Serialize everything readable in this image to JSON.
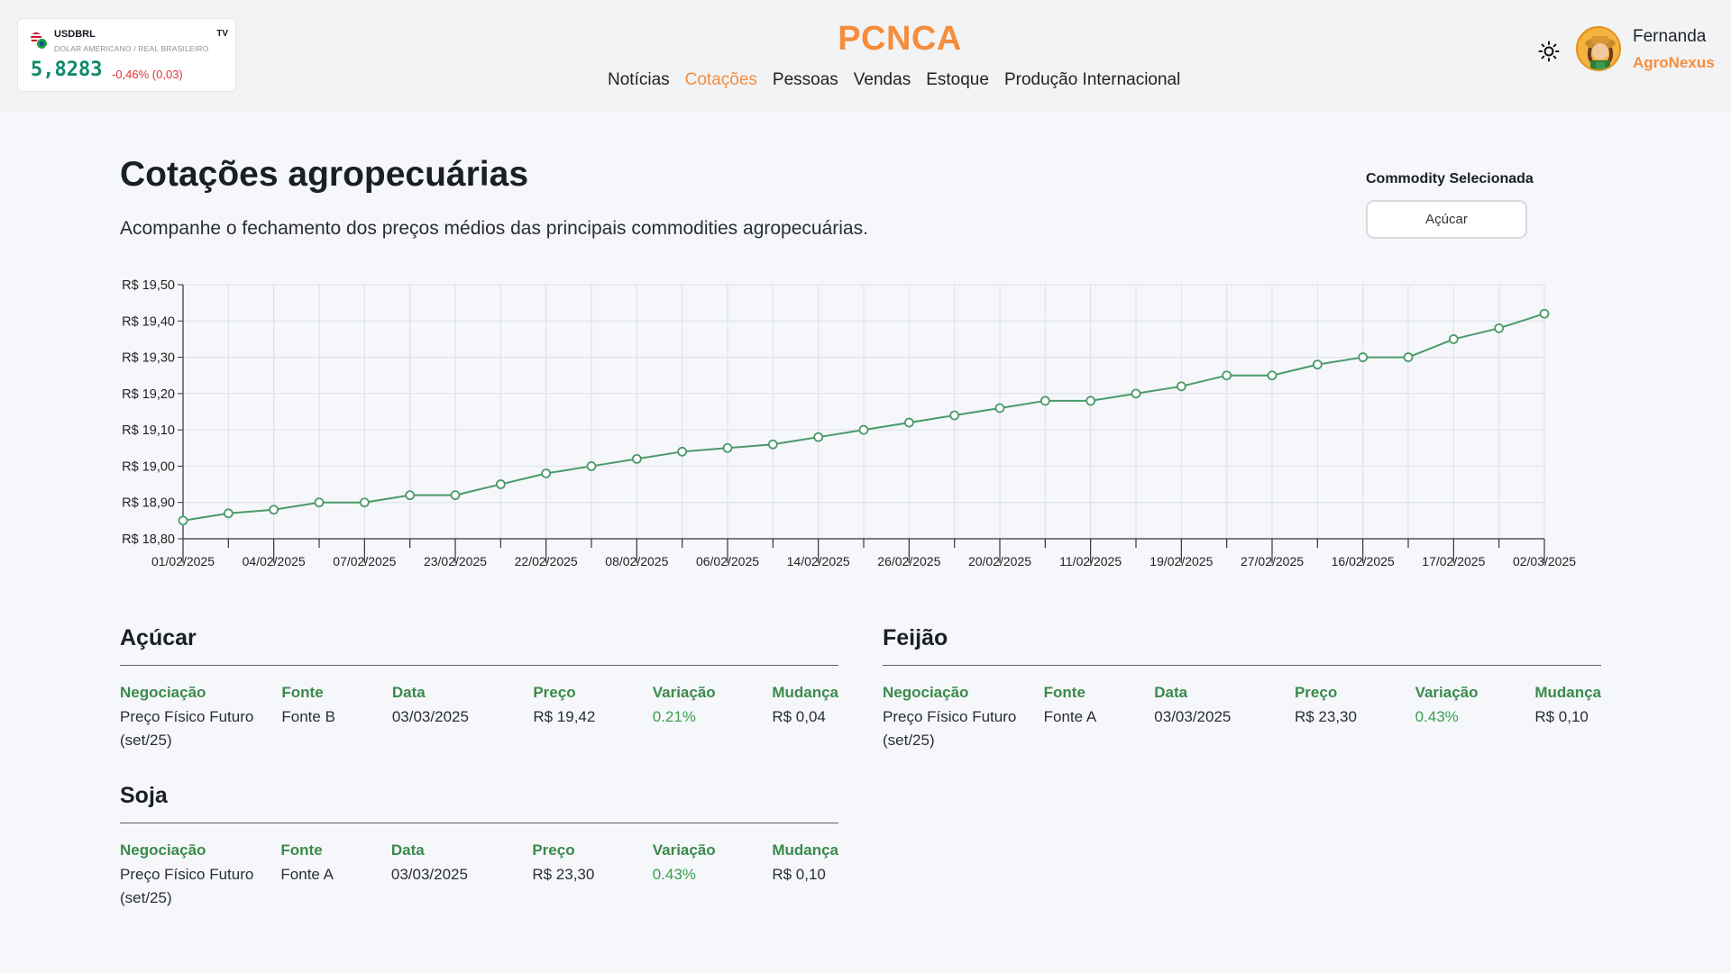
{
  "ticker": {
    "symbol": "USDBRL",
    "name": "DOLAR AMERICANO / REAL BRASILEIRO",
    "logo": "TV",
    "price": "5,8283",
    "change": "-0,46% (0,03)"
  },
  "header": {
    "brand": "PCNCA",
    "nav": [
      "Notícias",
      "Cotações",
      "Pessoas",
      "Vendas",
      "Estoque",
      "Produção Internacional"
    ],
    "active_nav": "Cotações",
    "theme_icon": "sun-icon",
    "user": {
      "name": "Fernanda",
      "org": "AgroNexus"
    }
  },
  "page": {
    "title": "Cotações agropecuárias",
    "subtitle": "Acompanhe o fechamento dos preços médios das principais commodities agropecuárias.",
    "selector_label": "Commodity Selecionada",
    "selector_value": "Açúcar"
  },
  "colors": {
    "accent": "#f58d3c",
    "line": "#4a9a68",
    "positive": "#38a04b",
    "header_green": "#3b8a4a"
  },
  "chart_data": {
    "type": "line",
    "y_ticks": [
      "R$ 19,50",
      "R$ 19,40",
      "R$ 19,30",
      "R$ 19,20",
      "R$ 19,10",
      "R$ 19,00",
      "R$ 18,90",
      "R$ 18,80"
    ],
    "ylim": [
      18.8,
      19.5
    ],
    "x_tick_labels": [
      "01/02/2025",
      "04/02/2025",
      "07/02/2025",
      "23/02/2025",
      "22/02/2025",
      "08/02/2025",
      "06/02/2025",
      "14/02/2025",
      "26/02/2025",
      "20/02/2025",
      "11/02/2025",
      "19/02/2025",
      "27/02/2025",
      "16/02/2025",
      "17/02/2025",
      "02/03/2025"
    ],
    "grid": true,
    "series": [
      {
        "values": [
          18.85,
          18.87,
          18.88,
          18.9,
          18.9,
          18.92,
          18.92,
          18.95,
          18.98,
          19.0,
          19.02,
          19.04,
          19.05,
          19.06,
          19.08,
          19.1,
          19.12,
          19.14,
          19.16,
          19.18,
          19.18,
          19.2,
          19.22,
          19.25,
          19.25,
          19.28,
          19.3,
          19.3,
          19.35,
          19.38,
          19.42
        ]
      }
    ]
  },
  "tables": {
    "columns": [
      "Negociação",
      "Fonte",
      "Data",
      "Preço",
      "Variação",
      "Mudança"
    ],
    "acucar": {
      "title": "Açúcar",
      "row": [
        "Preço Físico Futuro (set/25)",
        "Fonte B",
        "03/03/2025",
        "R$ 19,42",
        "0.21%",
        "R$ 0,04"
      ]
    },
    "feijao": {
      "title": "Feijão",
      "row": [
        "Preço Físico Futuro (set/25)",
        "Fonte A",
        "03/03/2025",
        "R$ 23,30",
        "0.43%",
        "R$ 0,10"
      ]
    },
    "soja": {
      "title": "Soja",
      "row": [
        "Preço Físico Futuro (set/25)",
        "Fonte A",
        "03/03/2025",
        "R$ 23,30",
        "0.43%",
        "R$ 0,10"
      ]
    }
  }
}
